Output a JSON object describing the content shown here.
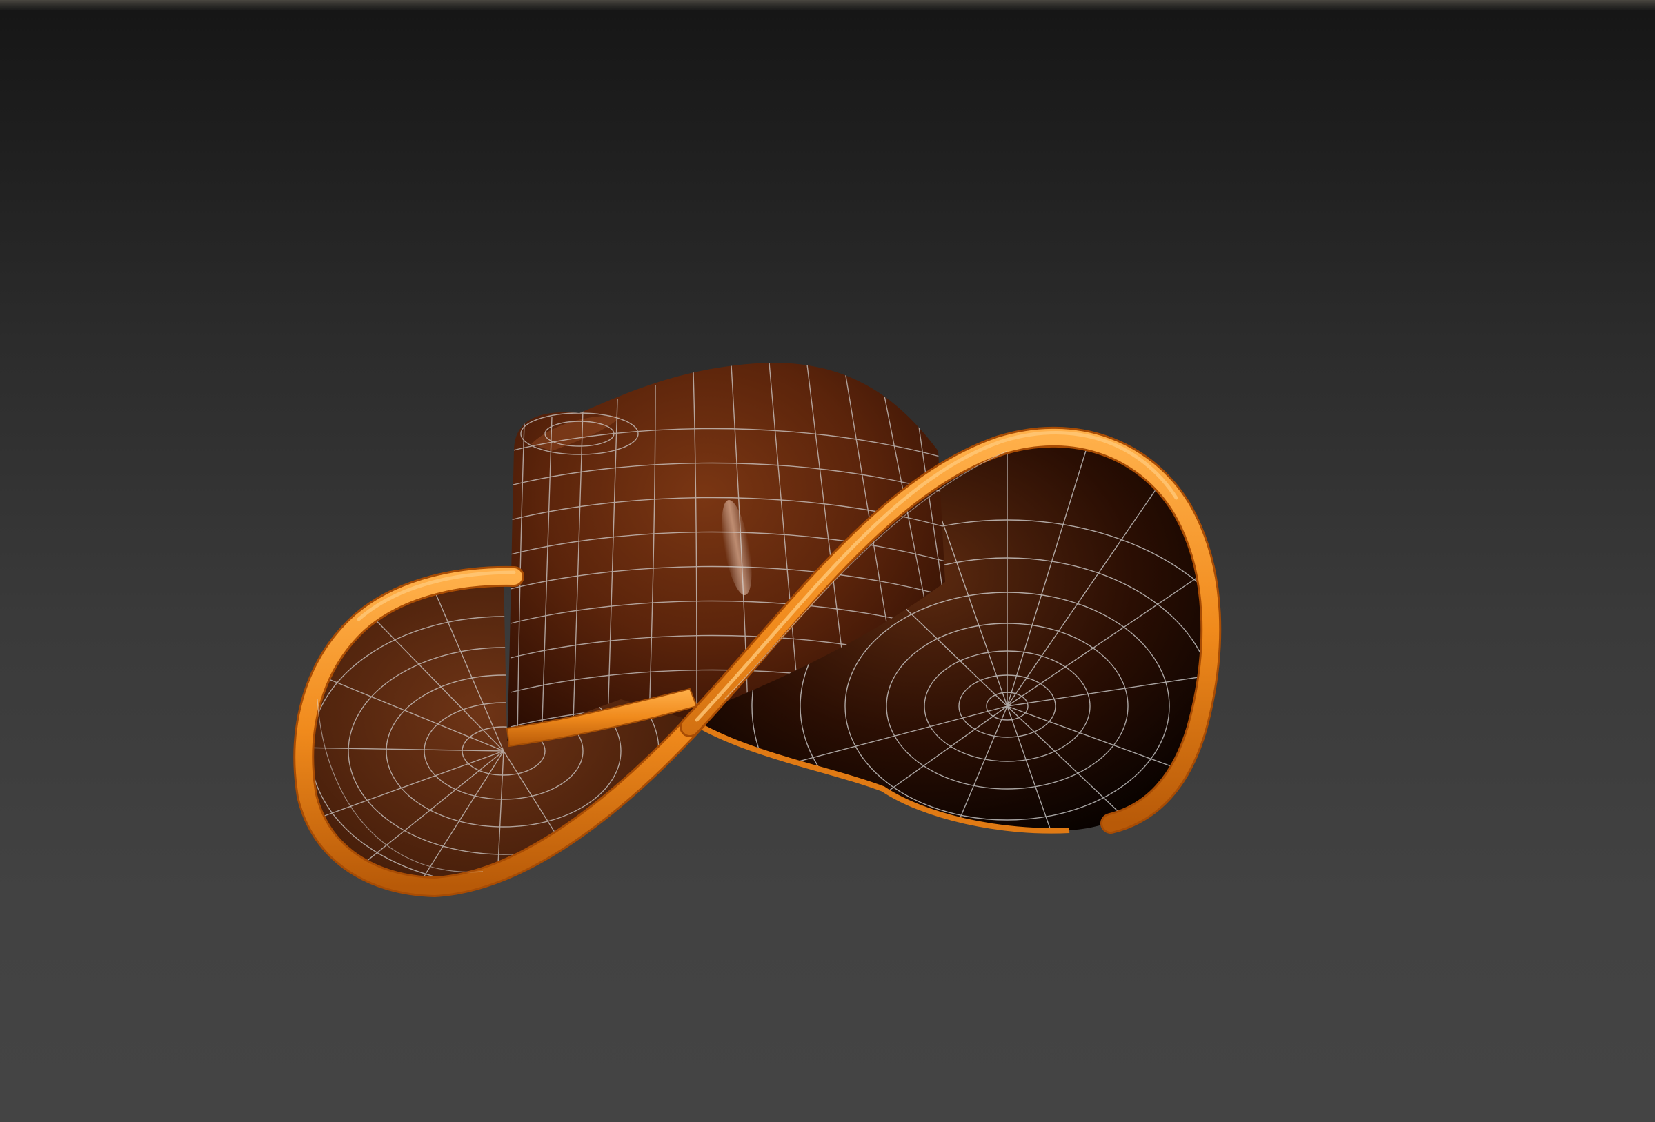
{
  "viewport": {
    "background_top": "#161616",
    "background_bottom": "#444444"
  },
  "model": {
    "object": "cowboy-hat",
    "display_mode": "shaded-with-wireframe",
    "colors": {
      "crown": "#6b2e10",
      "crown_dark": "#2a0c02",
      "brim_inner": "#5a2a12",
      "rim": "#f08a1c",
      "rim_highlight": "#ffb04a",
      "hatband": "#f08a1c",
      "wireframe": "#d8d8d8"
    }
  }
}
